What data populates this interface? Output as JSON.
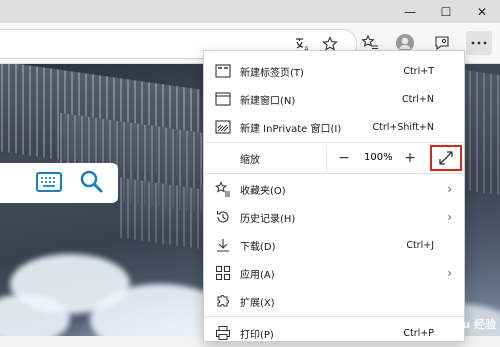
{
  "window": {
    "minimize_glyph": "—",
    "maximize_glyph": "☐",
    "close_glyph": "✕"
  },
  "menu": {
    "items": [
      {
        "icon": "new-tab-icon",
        "label": "新建标签页(T)",
        "shortcut": "Ctrl+T"
      },
      {
        "icon": "new-window-icon",
        "label": "新建窗口(N)",
        "shortcut": "Ctrl+N"
      },
      {
        "icon": "inprivate-icon",
        "label": "新建 InPrivate 窗口(I)",
        "shortcut": "Ctrl+Shift+N"
      },
      {
        "icon": "",
        "label": "缩放",
        "shortcut": ""
      },
      {
        "icon": "favorites-icon",
        "label": "收藏夹(O)",
        "shortcut": ""
      },
      {
        "icon": "history-icon",
        "label": "历史记录(H)",
        "shortcut": ""
      },
      {
        "icon": "download-icon",
        "label": "下载(D)",
        "shortcut": "Ctrl+J"
      },
      {
        "icon": "apps-icon",
        "label": "应用(A)",
        "shortcut": ""
      },
      {
        "icon": "extensions-icon",
        "label": "扩展(X)",
        "shortcut": ""
      },
      {
        "icon": "print-icon",
        "label": "打印(P)",
        "shortcut": "Ctrl+P"
      }
    ],
    "zoom": {
      "minus": "−",
      "value": "100%",
      "plus": "+"
    }
  },
  "watermark": "Baidu 经验"
}
